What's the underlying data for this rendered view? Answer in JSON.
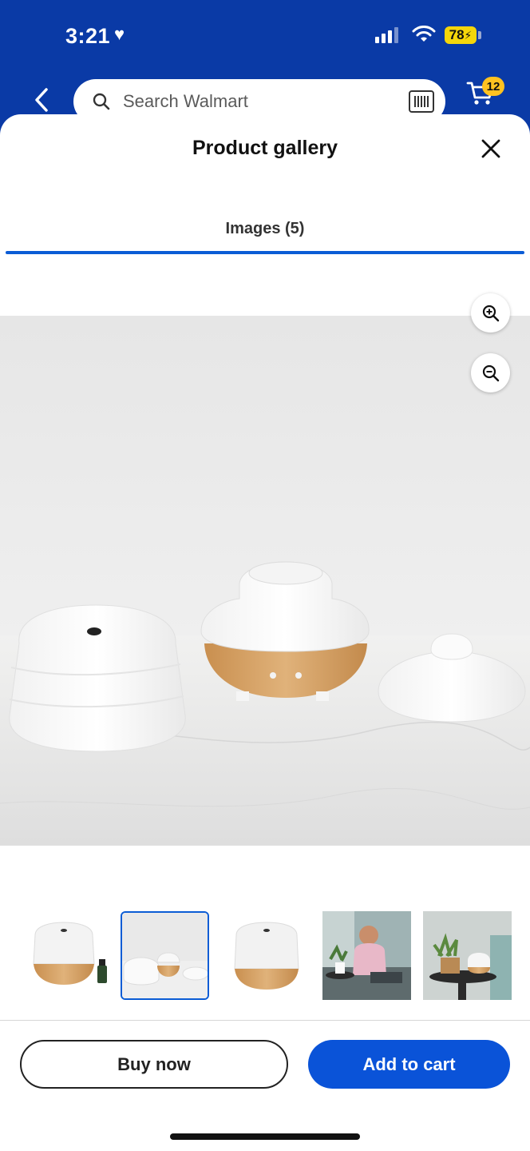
{
  "status_bar": {
    "time": "3:21",
    "battery": "78"
  },
  "header": {
    "search_placeholder": "Search Walmart",
    "cart_count": "12"
  },
  "gallery": {
    "title": "Product gallery",
    "tab_label": "Images (5)"
  },
  "thumbnails": [
    {
      "name": "diffuser-with-oil-bottle",
      "selected": false
    },
    {
      "name": "diffuser-disassembled",
      "selected": true
    },
    {
      "name": "diffuser-front",
      "selected": false
    },
    {
      "name": "man-in-living-room",
      "selected": false
    },
    {
      "name": "diffuser-on-table",
      "selected": false
    }
  ],
  "actions": {
    "buy_now": "Buy now",
    "add_to_cart": "Add to cart"
  },
  "colors": {
    "header_blue": "#0a3aa6",
    "accent_blue": "#0b5cd5",
    "cart_button": "#0a53d8",
    "badge_yellow": "#ffc220"
  }
}
